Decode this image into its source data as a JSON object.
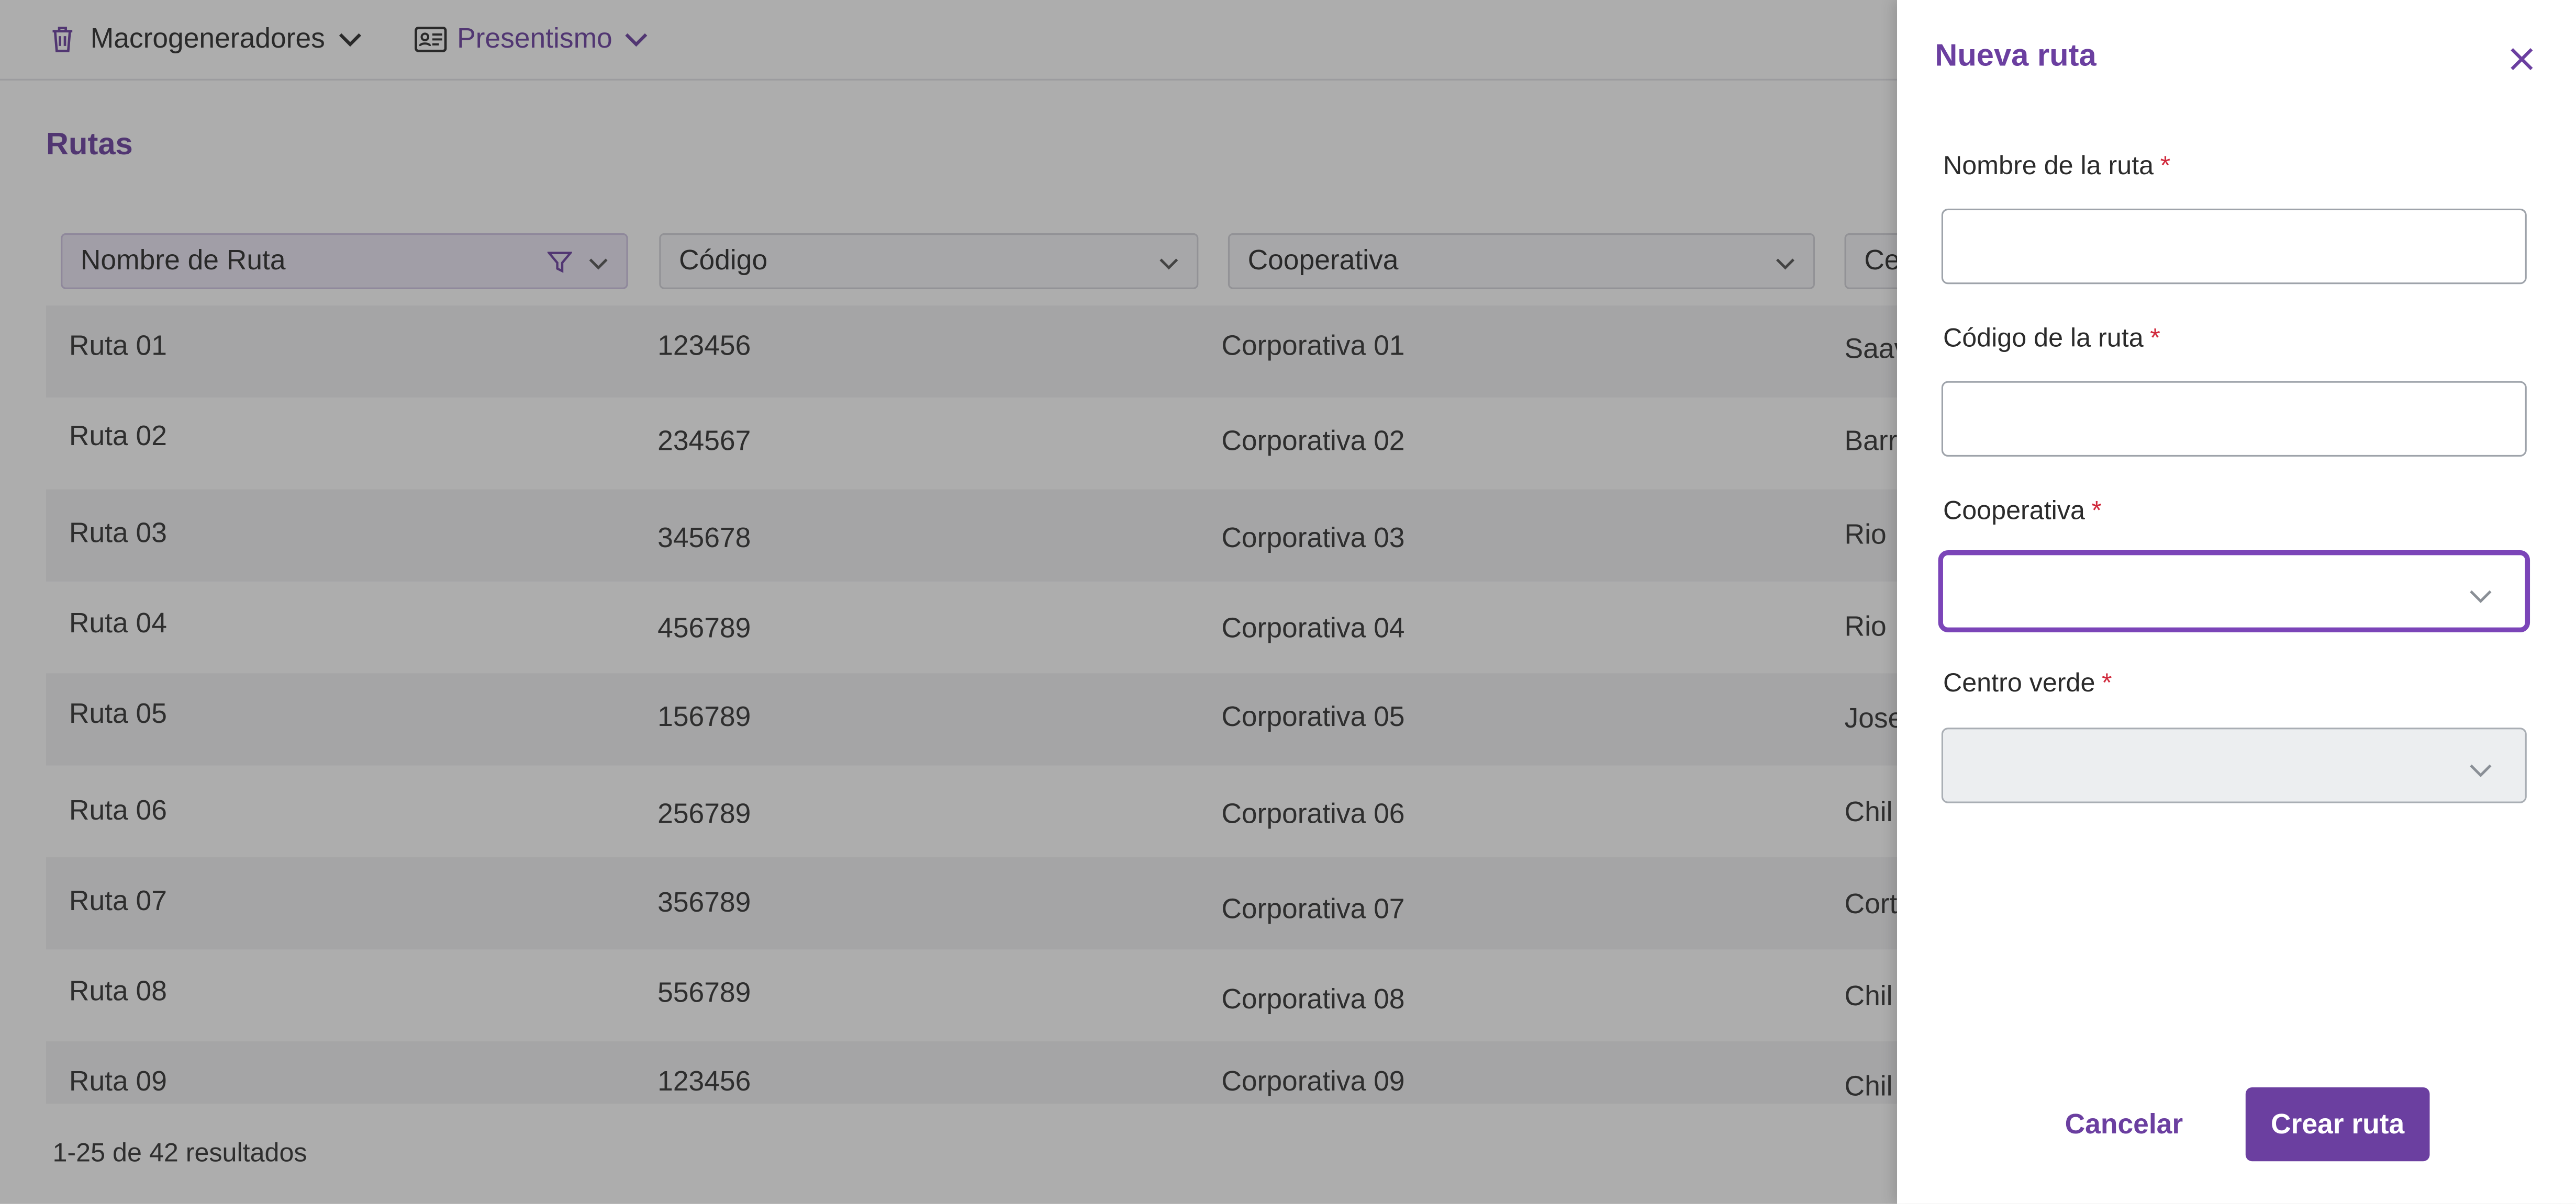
{
  "topnav": {
    "items": [
      {
        "label": "Macrogeneradores",
        "icon": "trash-icon"
      },
      {
        "label": "Presentismo",
        "icon": "id-card-icon"
      }
    ]
  },
  "page": {
    "title": "Rutas"
  },
  "table": {
    "columns": [
      "Nombre de Ruta",
      "Código",
      "Cooperativa",
      "Ce"
    ],
    "rows": [
      [
        "Ruta 01",
        "123456",
        "Corporativa 01",
        "Saav"
      ],
      [
        "Ruta 02",
        "234567",
        "Corporativa 02",
        "Barr"
      ],
      [
        "Ruta 03",
        "345678",
        "Corporativa 03",
        "Rio"
      ],
      [
        "Ruta 04",
        "456789",
        "Corporativa 04",
        "Rio"
      ],
      [
        "Ruta 05",
        "156789",
        "Corporativa 05",
        "Jose"
      ],
      [
        "Ruta 06",
        "256789",
        "Corporativa 06",
        "Chil"
      ],
      [
        "Ruta 07",
        "356789",
        "Corporativa 07",
        "Cort"
      ],
      [
        "Ruta 08",
        "556789",
        "Corporativa 08",
        "Chil"
      ],
      [
        "Ruta 09",
        "123456",
        "Corporativa 09",
        "Chil"
      ]
    ]
  },
  "footer": {
    "results": "1-25 de 42 resultados"
  },
  "drawer": {
    "title": "Nueva ruta",
    "fields": {
      "nombre": {
        "label": "Nombre de la ruta",
        "required_mark": "*",
        "value": ""
      },
      "codigo": {
        "label": "Código de la ruta",
        "required_mark": "*",
        "value": ""
      },
      "cooperativa": {
        "label": "Cooperativa",
        "required_mark": "*",
        "value": ""
      },
      "centro": {
        "label": "Centro verde",
        "required_mark": "*",
        "value": ""
      }
    },
    "cancel_label": "Cancelar",
    "create_label": "Crear ruta"
  },
  "colors": {
    "accent": "#6b3fa0",
    "focus": "#7b45b8",
    "required": "#d0283b"
  }
}
